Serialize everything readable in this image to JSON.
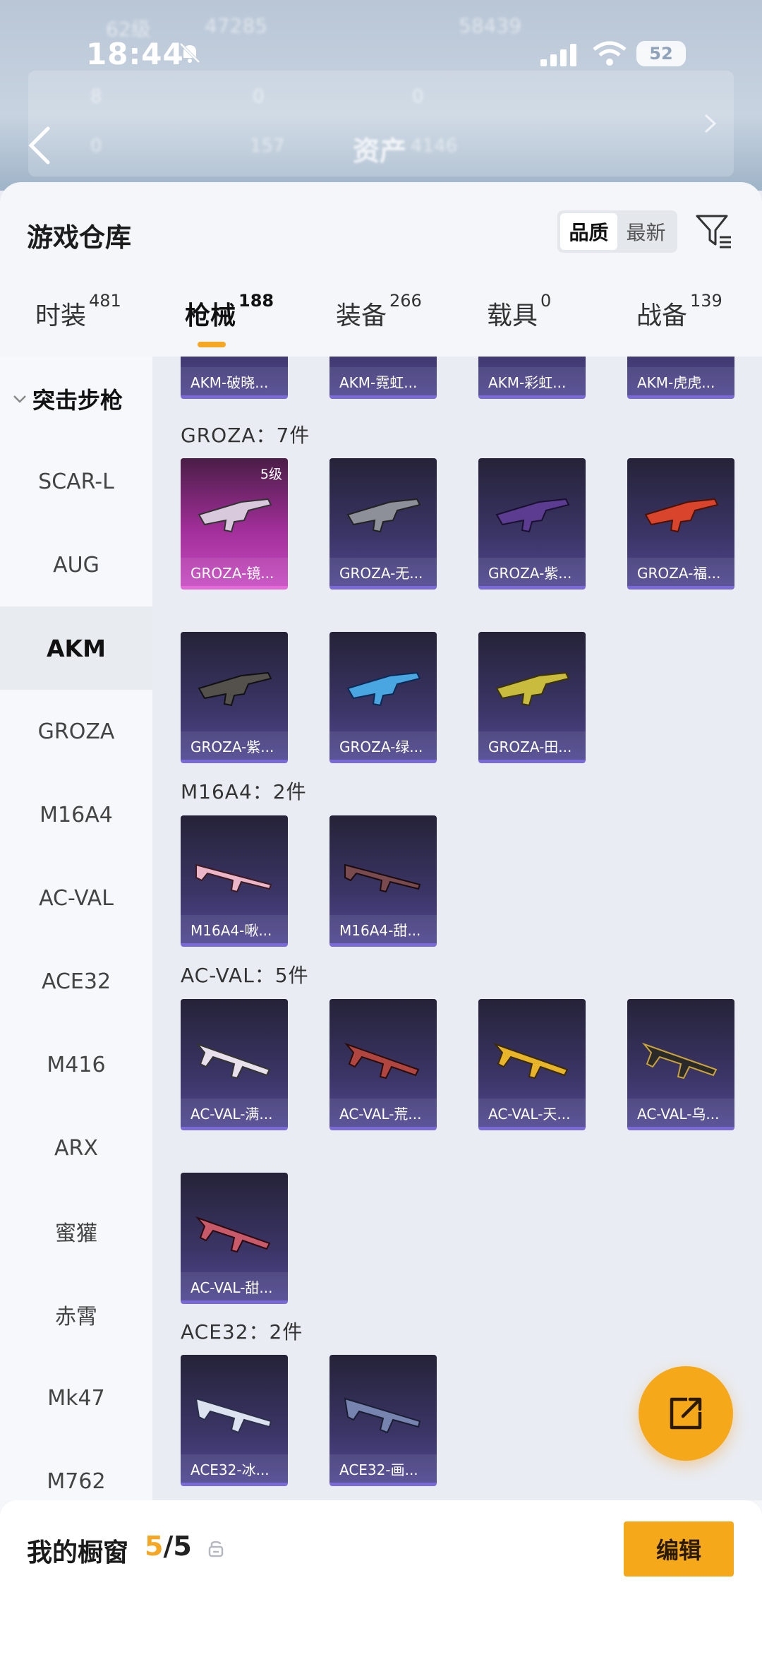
{
  "status_bar": {
    "time": "18:44",
    "battery": "52"
  },
  "header": {
    "blurred_level": "62级",
    "blurred_coins": "47285",
    "blurred_score": "58439",
    "stat_a": "8",
    "stat_b": "0",
    "stat_c": "0",
    "stat_d": "0",
    "stat_e": "157",
    "assets_label": "资产",
    "assets_value": "4146"
  },
  "warehouse": {
    "title": "游戏仓库",
    "sort_options": [
      "品质",
      "最新"
    ],
    "sort_selected": "品质"
  },
  "tabs": [
    {
      "label": "时装",
      "count": "481"
    },
    {
      "label": "枪械",
      "count": "188"
    },
    {
      "label": "装备",
      "count": "266"
    },
    {
      "label": "载具",
      "count": "0"
    },
    {
      "label": "战备",
      "count": "139"
    }
  ],
  "sidebar": {
    "category": "突击步枪",
    "items": [
      "SCAR-L",
      "AUG",
      "AKM",
      "GROZA",
      "M16A4",
      "AC-VAL",
      "ACE32",
      "M416",
      "ARX",
      "蜜獾",
      "赤霄",
      "Mk47",
      "M762"
    ],
    "selected": "AKM"
  },
  "groups": {
    "akm_partial": [
      "AKM-破晓...",
      "AKM-霓虹...",
      "AKM-彩虹...",
      "AKM-虎虎..."
    ],
    "groza": {
      "label": "GROZA：7件",
      "level_badge": "5级",
      "items": [
        "GROZA-镜...",
        "GROZA-无...",
        "GROZA-紫...",
        "GROZA-福...",
        "GROZA-紫...",
        "GROZA-绿...",
        "GROZA-田..."
      ]
    },
    "m16a4": {
      "label": "M16A4：2件",
      "items": [
        "M16A4-啾...",
        "M16A4-甜..."
      ]
    },
    "acval": {
      "label": "AC-VAL：5件",
      "items": [
        "AC-VAL-满...",
        "AC-VAL-荒...",
        "AC-VAL-天...",
        "AC-VAL-乌...",
        "AC-VAL-甜..."
      ]
    },
    "ace32": {
      "label": "ACE32：2件",
      "items": [
        "ACE32-冰...",
        "ACE32-画..."
      ]
    }
  },
  "showcase": {
    "label": "我的橱窗",
    "current": "5",
    "separator": "/",
    "total": "5",
    "edit_label": "编辑"
  },
  "colors": {
    "accent": "#f6a81b",
    "card_purple": "#3b3566",
    "card_pink": "#a02e98"
  }
}
